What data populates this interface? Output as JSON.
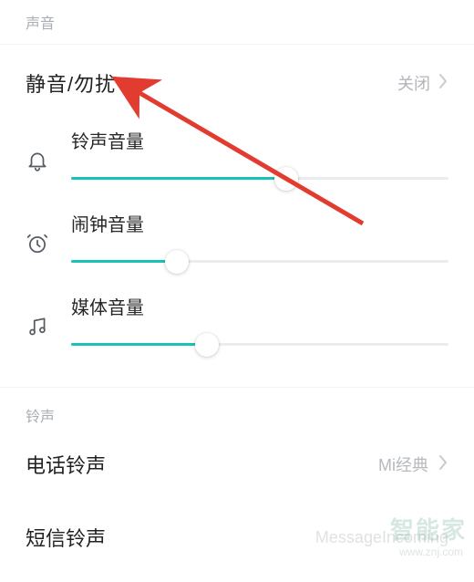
{
  "header": {
    "section_label_volume": "声音",
    "section_label_ringtone": "铃声"
  },
  "dnd": {
    "title": "静音/勿扰",
    "value": "关闭"
  },
  "sliders": {
    "ring": {
      "label": "铃声音量",
      "percent": 57
    },
    "alarm": {
      "label": "闹钟音量",
      "percent": 28
    },
    "media": {
      "label": "媒体音量",
      "percent": 36
    }
  },
  "ringtones": {
    "phone": {
      "label": "电话铃声",
      "value": "Mi经典"
    },
    "sms": {
      "label": "短信铃声",
      "value": "MessageIncoming"
    }
  },
  "watermark": {
    "main": "智能家",
    "sub": "www.znj.com"
  },
  "colors": {
    "accent": "#18c3b4",
    "arrow": "#e23b2f"
  }
}
